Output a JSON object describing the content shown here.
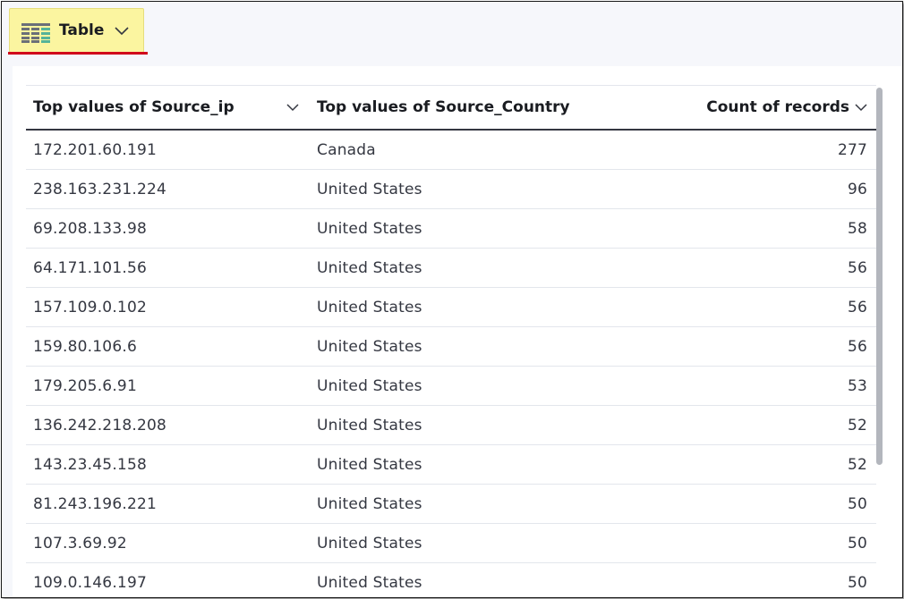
{
  "toolbar": {
    "viz_type_label": "Table",
    "viz_icon": "table-icon",
    "chevron_icon": "chevron-down-icon",
    "accent_color": "#fbf5a0",
    "underline_color": "#d0011b"
  },
  "table": {
    "columns": [
      {
        "label": "Top values of Source_ip"
      },
      {
        "label": "Top values of Source_Country"
      },
      {
        "label": "Count of records"
      }
    ],
    "rows": [
      {
        "ip": "172.201.60.191",
        "country": "Canada",
        "count": "277"
      },
      {
        "ip": "238.163.231.224",
        "country": "United States",
        "count": "96"
      },
      {
        "ip": "69.208.133.98",
        "country": "United States",
        "count": "58"
      },
      {
        "ip": "64.171.101.56",
        "country": "United States",
        "count": "56"
      },
      {
        "ip": "157.109.0.102",
        "country": "United States",
        "count": "56"
      },
      {
        "ip": "159.80.106.6",
        "country": "United States",
        "count": "56"
      },
      {
        "ip": "179.205.6.91",
        "country": "United States",
        "count": "53"
      },
      {
        "ip": "136.242.218.208",
        "country": "United States",
        "count": "52"
      },
      {
        "ip": "143.23.45.158",
        "country": "United States",
        "count": "52"
      },
      {
        "ip": "81.243.196.221",
        "country": "United States",
        "count": "50"
      },
      {
        "ip": "107.3.69.92",
        "country": "United States",
        "count": "50"
      },
      {
        "ip": "109.0.146.197",
        "country": "United States",
        "count": "50"
      }
    ]
  }
}
